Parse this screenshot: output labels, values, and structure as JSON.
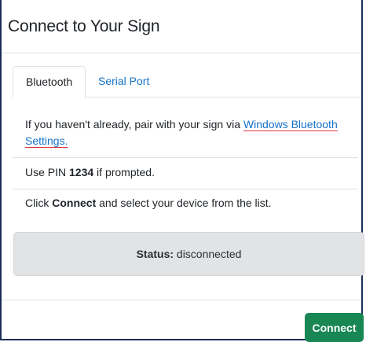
{
  "dialog": {
    "title": "Connect to Your Sign"
  },
  "tabs": [
    {
      "label": "Bluetooth",
      "active": true
    },
    {
      "label": "Serial Port",
      "active": false
    }
  ],
  "instructions": {
    "pair": {
      "prefix": "If you haven't already, pair with your sign via ",
      "link_text": "Windows Bluetooth Settings."
    },
    "pin": {
      "prefix": "Use PIN ",
      "pin_value": "1234",
      "suffix": " if prompted."
    },
    "connect": {
      "prefix": "Click ",
      "bold_word": "Connect",
      "suffix": " and select your device from the list."
    }
  },
  "status": {
    "label": "Status:",
    "value": " disconnected"
  },
  "footer": {
    "connect_label": "Connect"
  },
  "colors": {
    "accent_link": "#1672c7",
    "success_button": "#198754",
    "status_background": "#e2e3e5",
    "window_border": "#1d2f57"
  }
}
